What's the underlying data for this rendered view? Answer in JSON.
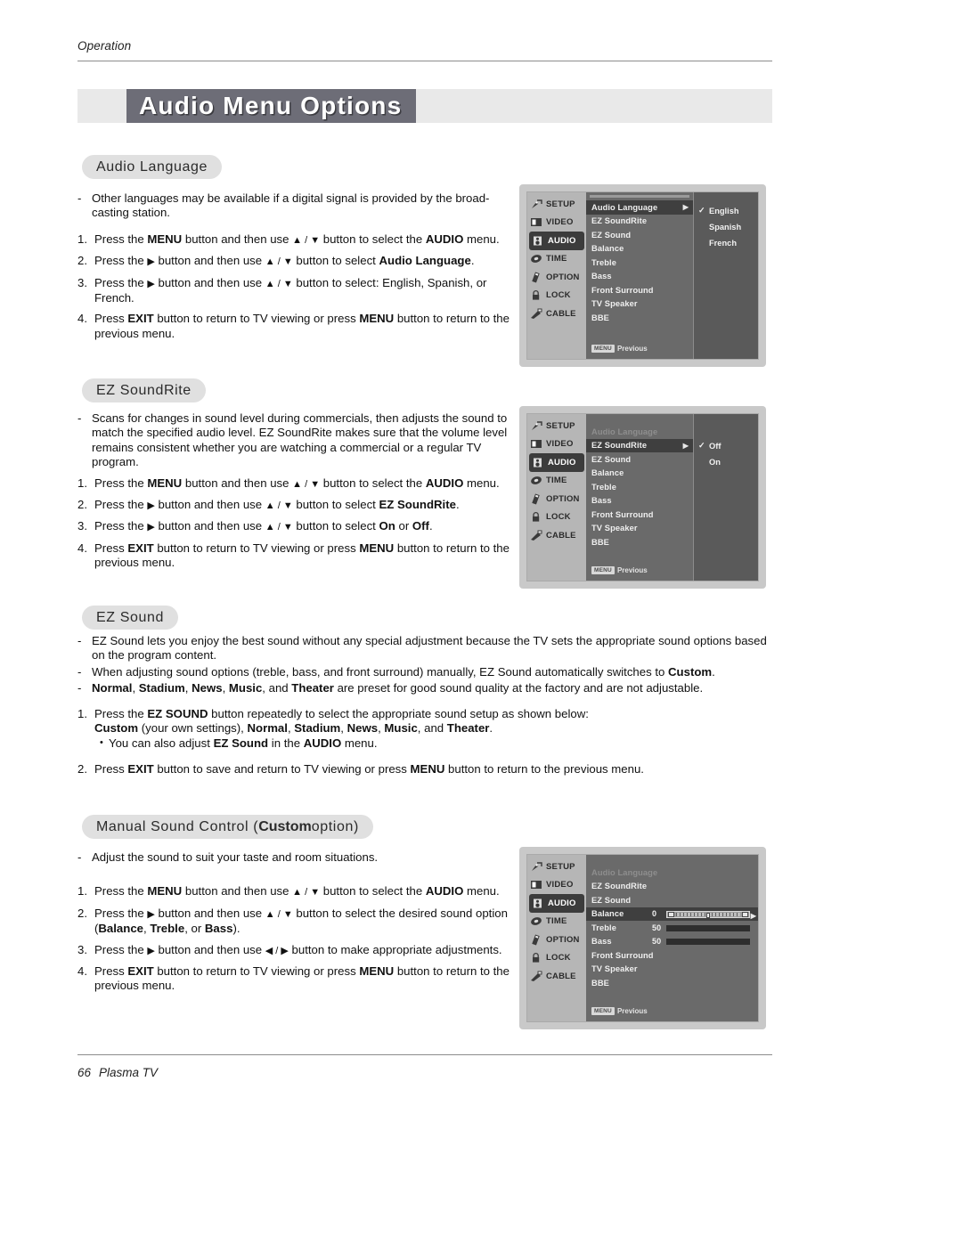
{
  "document": {
    "running_head": "Operation",
    "banner_title": "Audio Menu Options",
    "footer_page": "66",
    "footer_label": "Plasma TV"
  },
  "sections": {
    "audio_language": {
      "pill": "Audio Language",
      "dash1": "Other languages may be available if a digital signal is provided by the broad-casting station.",
      "step1_a": "Press the ",
      "step1_b": "MENU",
      "step1_c": " button and then use ",
      "step1_d": " button to select the ",
      "step1_e": "AUDIO",
      "step1_f": " menu.",
      "step2_a": "Press the ",
      "step2_c": " button and then use ",
      "step2_d": " button to select ",
      "step2_e": "Audio Language",
      "step2_f": ".",
      "step3_a": "Press the ",
      "step3_c": " button and then use ",
      "step3_d": " button to select: English, Spanish, or French.",
      "step4_a": "Press ",
      "step4_b": "EXIT",
      "step4_c": " button to return to TV viewing or press ",
      "step4_d": "MENU",
      "step4_e": " button to return to the previous menu."
    },
    "ez_soundrite": {
      "pill": "EZ SoundRite",
      "dash1": "Scans for changes in sound level during commercials, then adjusts the sound to match the specified audio level. EZ SoundRite makes sure that the volume level remains consistent whether you are watching a commercial or a regular TV program.",
      "step2_e": "EZ SoundRite",
      "step3_d": " button to select ",
      "step3_on": "On",
      "step3_or": " or ",
      "step3_off": "Off",
      "step3_dot": "."
    },
    "ez_sound": {
      "pill": "EZ Sound",
      "dash1": "EZ Sound lets you enjoy the best sound without any special adjustment because the TV sets the appropriate sound options based on the program content.",
      "dash2_a": "When adjusting sound options (treble, bass, and front surround) manually, EZ Sound automatically switches to ",
      "dash2_b": "Custom",
      "dash2_c": ".",
      "dash3_a": "Normal",
      "dash3_b": "Stadium",
      "dash3_c": "News",
      "dash3_d": "Music",
      "dash3_e": ", and ",
      "dash3_f": "Theater",
      "dash3_g": " are preset for good sound quality at the factory and are not adjustable.",
      "step1_a": "Press the ",
      "step1_b": "EZ SOUND",
      "step1_c": " button repeatedly to select the appropriate sound setup as shown below:",
      "step1_l2_a": "Custom",
      "step1_l2_b": " (your own settings), ",
      "step1_l2_c": "Normal",
      "step1_l2_d": "Stadium",
      "step1_l2_e": "News",
      "step1_l2_f": "Music",
      "step1_l2_g": ", and ",
      "step1_l2_h": "Theater",
      "step1_l2_i": ".",
      "bullet_a": "You can also adjust ",
      "bullet_b": "EZ Sound",
      "bullet_c": " in the ",
      "bullet_d": "AUDIO",
      "bullet_e": " menu.",
      "step2_a": "Press ",
      "step2_b": "EXIT",
      "step2_c": " button to save and return to TV viewing or press ",
      "step2_d": "MENU",
      "step2_e": " button to return to the previous menu."
    },
    "manual_sound": {
      "pill_a": "Manual Sound Control (",
      "pill_b": "Custom",
      "pill_c": " option)",
      "dash1": "Adjust the sound to suit your taste and room situations.",
      "step2_d": " button to select the desired sound option",
      "step2_l2_open": "(",
      "step2_l2_a": "Balance",
      "step2_l2_b": "Treble",
      "step2_l2_or": ", or ",
      "step2_l2_c": "Bass",
      "step2_l2_close": ").",
      "step3_a": "Press the ",
      "step3_c": " button and then use ",
      "step3_d": " button to make appropriate adjustments."
    }
  },
  "osd": {
    "sidebar": [
      {
        "label": "SETUP",
        "icon": "satellite-dish-icon",
        "active": false
      },
      {
        "label": "VIDEO",
        "icon": "monitor-icon",
        "active": false
      },
      {
        "label": "AUDIO",
        "icon": "speaker-icon",
        "active": true
      },
      {
        "label": "TIME",
        "icon": "clock-icon",
        "active": false
      },
      {
        "label": "OPTION",
        "icon": "remote-icon",
        "active": false
      },
      {
        "label": "LOCK",
        "icon": "padlock-icon",
        "active": false
      },
      {
        "label": "CABLE",
        "icon": "cable-plug-icon",
        "active": false
      }
    ],
    "menu_items": [
      "Audio Language",
      "EZ SoundRite",
      "EZ Sound",
      "Balance",
      "Treble",
      "Bass",
      "Front Surround",
      "TV Speaker",
      "BBE"
    ],
    "previous_key": "MENU",
    "previous_label": "Previous",
    "screen1": {
      "selected_item": "Audio Language",
      "options": [
        {
          "label": "English",
          "checked": true
        },
        {
          "label": "Spanish",
          "checked": false
        },
        {
          "label": "French",
          "checked": false
        }
      ]
    },
    "screen2": {
      "selected_item": "EZ SoundRite",
      "dimmed_item": "Audio Language",
      "options": [
        {
          "label": "Off",
          "checked": true
        },
        {
          "label": "On",
          "checked": false
        }
      ]
    },
    "screen3": {
      "selected_item": "Balance",
      "dimmed_item": "Audio Language",
      "values": {
        "balance": "0",
        "treble": "50",
        "bass": "50"
      }
    }
  },
  "colors": {
    "banner_box": "#6d6d77",
    "banner_band": "#e9e9e9",
    "pill": "#e0e0e0",
    "osd_frame": "#c9c9c9",
    "osd_panel": "#5a5a5a",
    "osd_sidebar": "#b6b6b6",
    "osd_selected": "#3f3f3f"
  }
}
